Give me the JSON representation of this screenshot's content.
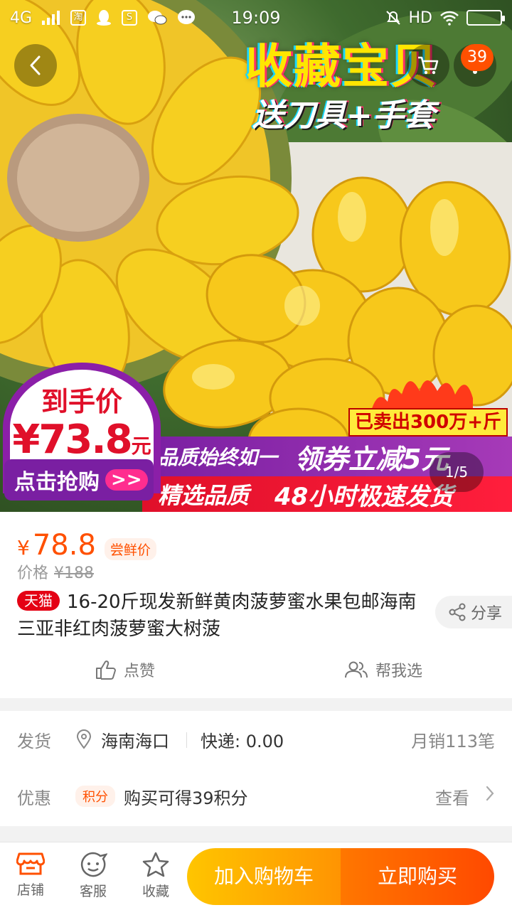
{
  "status_bar": {
    "network": "4G",
    "time": "19:09",
    "hd": "HD",
    "app_icons": [
      "taobao-icon",
      "qq-icon",
      "s-app-icon",
      "wechat-icon",
      "message-icon"
    ]
  },
  "header": {
    "cart_badge": "39"
  },
  "banner": {
    "promo_title": "收藏宝贝",
    "promo_sub": "送刀具+手套",
    "sold_tag": "已卖出300万+斤",
    "price_caption": "到手价",
    "price_currency": "¥",
    "price_value": "73.8",
    "price_unit": "元",
    "grab_button": "点击抢购",
    "grab_arrows": ">>",
    "strip1_a": "品质始终如一",
    "strip1_b": "领券立减5元",
    "strip2_a": "精选品质",
    "strip2_b": "48小时极速发货",
    "page_indicator": "1/5",
    "colors": {
      "accent_purple": "#7a1fa2",
      "accent_red": "#e0102a",
      "accent_yellow": "#ffe600"
    }
  },
  "product": {
    "currency": "¥",
    "price": "78.8",
    "price_tag": "尝鲜价",
    "orig_label": "价格",
    "orig_price": "¥188",
    "store_badge": "天猫",
    "title": "16-20斤现发新鲜黄肉菠萝蜜水果包邮海南三亚非红肉菠萝蜜大树菠",
    "share_label": "分享",
    "like_label": "点赞",
    "help_label": "帮我选",
    "colors": {
      "price": "#ff5000",
      "tmall": "#e40114"
    }
  },
  "shipping": {
    "ship_label": "发货",
    "location": "海南海口",
    "fee": "快递: 0.00",
    "monthly_sales": "月销113笔",
    "promo_label": "优惠",
    "points_badge": "积分",
    "points_text": "购买可得39积分",
    "view_label": "查看"
  },
  "bottom_bar": {
    "shop_label": "店铺",
    "service_label": "客服",
    "favorite_label": "收藏",
    "add_cart_label": "加入购物车",
    "buy_now_label": "立即购买",
    "colors": {
      "cart_start": "#ffc500",
      "cart_end": "#ff9402",
      "buy_start": "#ff7700",
      "buy_end": "#ff4900"
    }
  }
}
